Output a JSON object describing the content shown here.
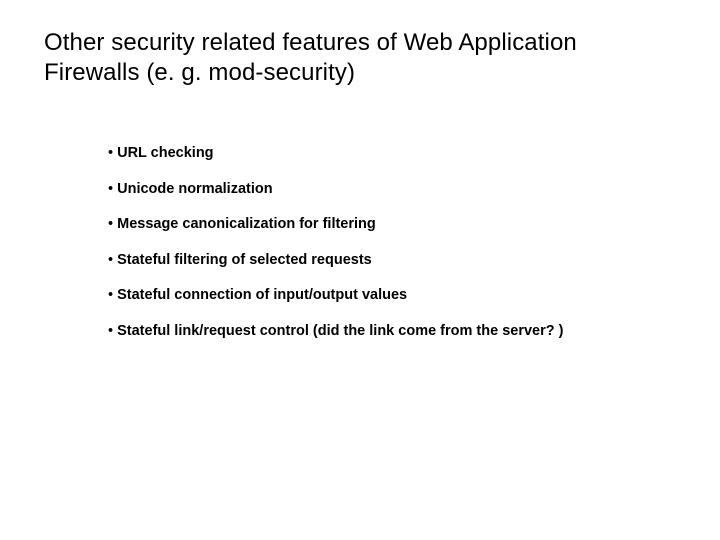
{
  "title": "Other security related features of Web Application Firewalls (e. g. mod-security)",
  "bullets": [
    "URL checking",
    "Unicode normalization",
    "Message canonicalization for filtering",
    "Stateful filtering of selected requests",
    "Stateful connection of input/output values",
    "Stateful link/request control (did the link come from the server? )"
  ]
}
